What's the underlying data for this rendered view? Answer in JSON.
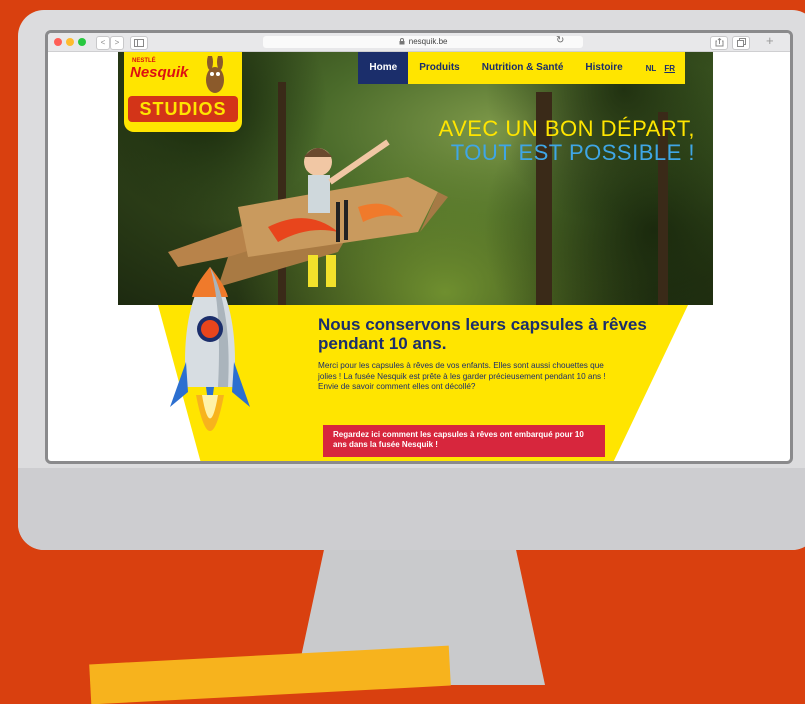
{
  "browser": {
    "url": "nesquik.be",
    "lock_icon": "lock-icon",
    "back_label": "<",
    "forward_label": ">"
  },
  "logo": {
    "brand": "NESTLÉ",
    "name": "Nesquik",
    "studios": "STUDIOS"
  },
  "nav": {
    "items": [
      {
        "label": "Home",
        "active": true
      },
      {
        "label": "Produits"
      },
      {
        "label": "Nutrition & Santé"
      },
      {
        "label": "Histoire"
      }
    ],
    "languages": [
      "NL",
      "FR"
    ]
  },
  "hero": {
    "headline_line1": "AVEC UN BON DÉPART,",
    "headline_line2": "TOUT EST POSSIBLE !"
  },
  "section": {
    "title": "Nous conservons leurs capsules à rêves pendant 10 ans.",
    "body": "Merci pour les capsules à rêves de vos enfants. Elles sont aussi chouettes que jolies ! La fusée Nesquik est prête à les garder précieusement pendant 10 ans ! Envie de savoir comment elles ont décollé?",
    "cta": "Regardez ici comment les capsules à rêves ont embarqué pour 10 ans dans la fusée Nesquik !"
  },
  "colors": {
    "background": "#d9400f",
    "yellow": "#ffe500",
    "navy": "#1b2e6b",
    "cta_red": "#d7263d",
    "headline_blue": "#3fa6e6"
  }
}
